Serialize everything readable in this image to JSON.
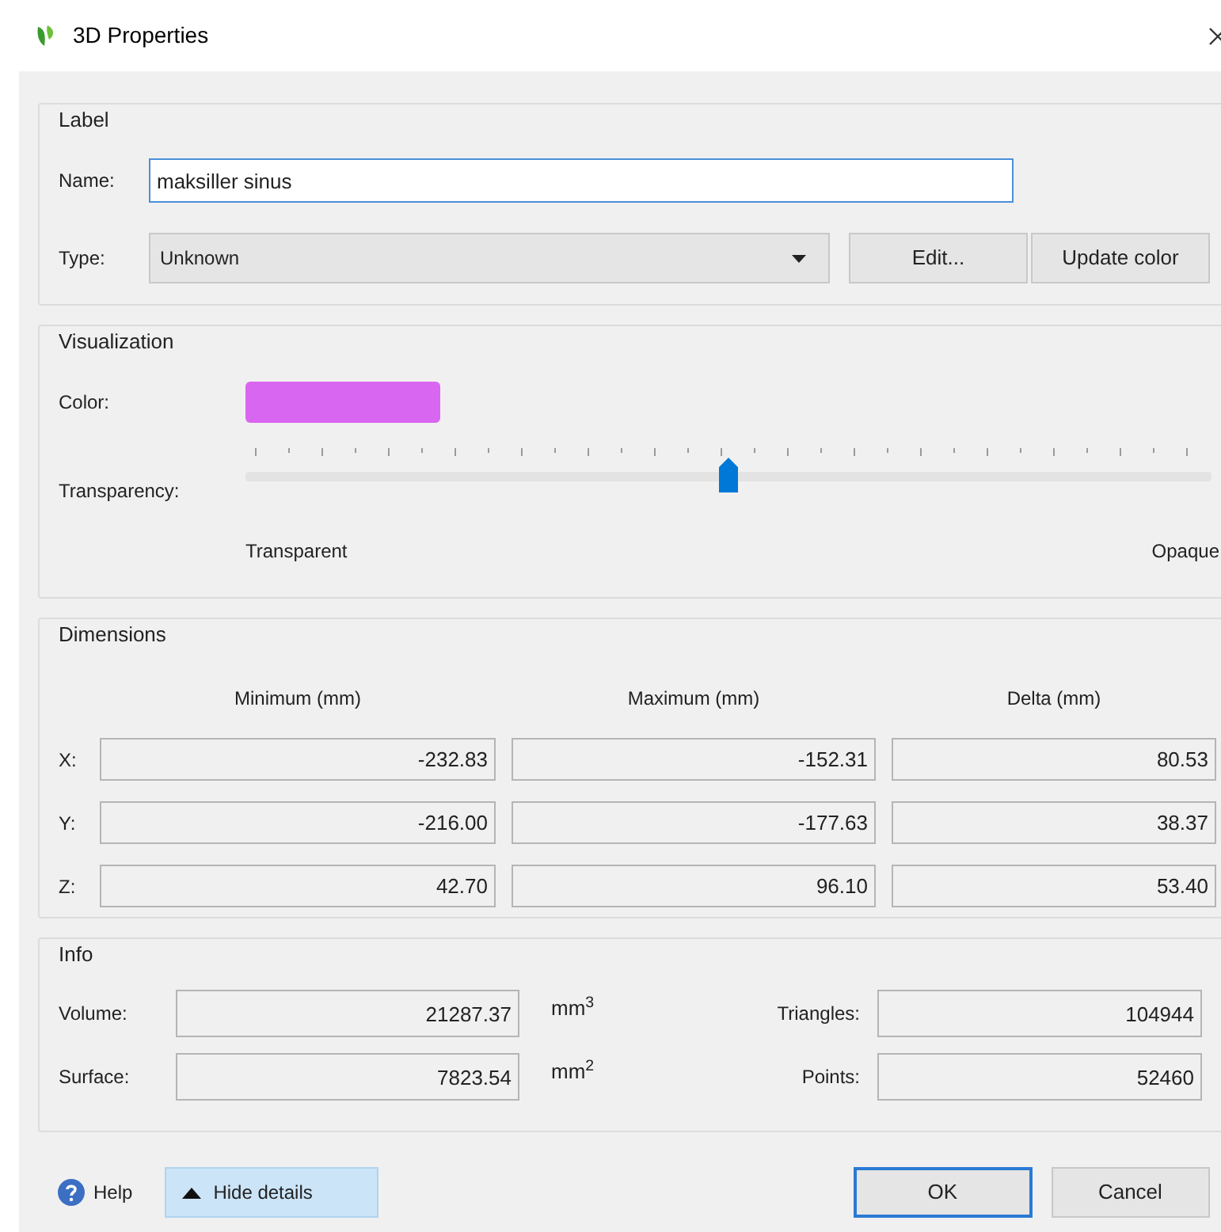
{
  "window": {
    "title": "3D Properties"
  },
  "label_group": {
    "title": "Label",
    "name": {
      "label": "Name:",
      "value": "maksiller sinus"
    },
    "type": {
      "label": "Type:",
      "value": "Unknown"
    },
    "buttons": [
      "Edit...",
      "Update color"
    ]
  },
  "visualization": {
    "title": "Visualization",
    "color": {
      "label": "Color:",
      "color": "#d966f0"
    },
    "transparency": {
      "label": "Transparency:",
      "level": 0.5,
      "min_label": "Transparent",
      "max_label": "Opaque"
    }
  },
  "dimensions": {
    "title": "Dimensions",
    "columns": [
      "Minimum (mm)",
      "Maximum (mm)",
      "Delta (mm)"
    ],
    "rows": [
      {
        "axis": "X:",
        "values": [
          "-232.83",
          "-152.31",
          "80.53"
        ]
      },
      {
        "axis": "Y:",
        "values": [
          "-216.00",
          "-177.63",
          "38.37"
        ]
      },
      {
        "axis": "Z:",
        "values": [
          "42.70",
          "96.10",
          "53.40"
        ]
      }
    ]
  },
  "info": {
    "title": "Info",
    "rows": [
      {
        "label": "Volume:",
        "value": "21287.37",
        "unit": "mm$^{3}$",
        "label_2": "Triangles:",
        "value_2": "104944"
      },
      {
        "label": "Surface:",
        "value": "7823.54",
        "unit": "mm$^{2}$",
        "label_2": "Points:",
        "value_2": "52460"
      }
    ]
  },
  "footer": {
    "help": "Help",
    "details": {
      "label": "Hide details",
      "expanded": true
    },
    "ok": "OK",
    "cancel": "Cancel"
  }
}
